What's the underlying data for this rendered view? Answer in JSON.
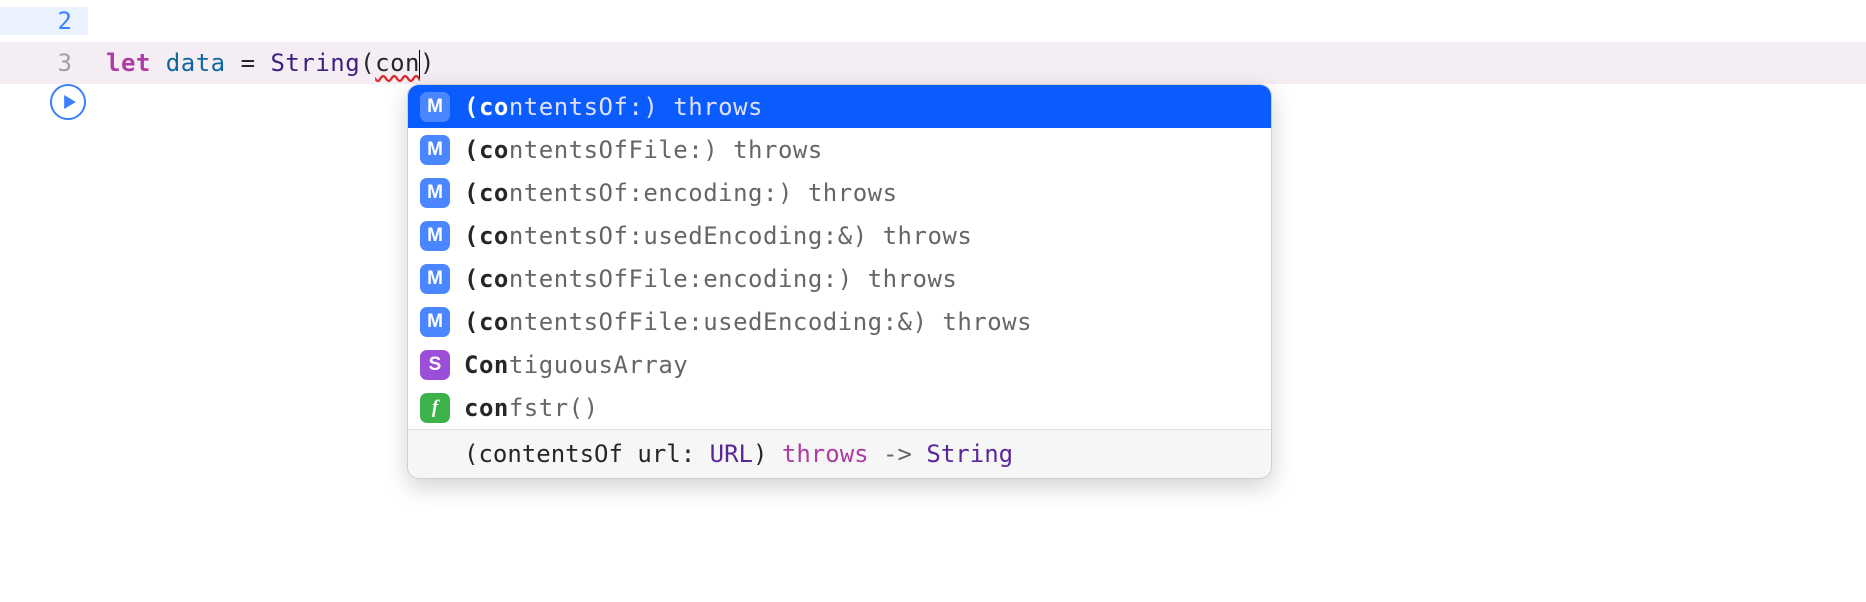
{
  "lines": {
    "l2": {
      "num": "2"
    },
    "l3": {
      "num": "3",
      "let": "let",
      "ident": " data ",
      "eq": "= ",
      "func": "String",
      "open": "(",
      "typed": "con",
      "close": ")"
    }
  },
  "completions": [
    {
      "kind": "M",
      "match": "(co",
      "rest": "ntentsOf:) throws",
      "selected": true
    },
    {
      "kind": "M",
      "match": "(co",
      "rest": "ntentsOfFile:) throws",
      "selected": false
    },
    {
      "kind": "M",
      "match": "(co",
      "rest": "ntentsOf:encoding:) throws",
      "selected": false
    },
    {
      "kind": "M",
      "match": "(co",
      "rest": "ntentsOf:usedEncoding:&) throws",
      "selected": false
    },
    {
      "kind": "M",
      "match": "(co",
      "rest": "ntentsOfFile:encoding:) throws",
      "selected": false
    },
    {
      "kind": "M",
      "match": "(co",
      "rest": "ntentsOfFile:usedEncoding:&) throws",
      "selected": false
    },
    {
      "kind": "S",
      "match": "Con",
      "rest": "tiguousArray",
      "selected": false
    },
    {
      "kind": "f",
      "match": "con",
      "rest": "fstr()",
      "selected": false
    }
  ],
  "footer": {
    "pre": "(contentsOf url: ",
    "type": "URL",
    "mid": ") ",
    "throws": "throws",
    "arrow": " -> ",
    "ret": "String"
  }
}
